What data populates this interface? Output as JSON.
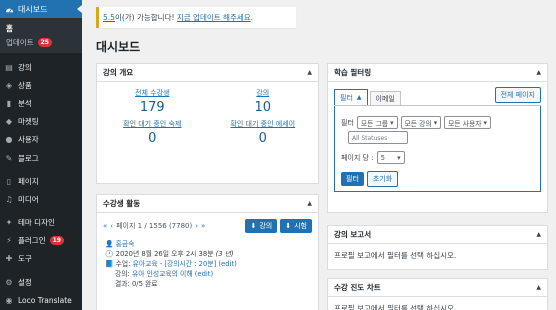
{
  "sidebar": {
    "dashboard_label": "대시보드",
    "sub_items": [
      {
        "label": "홈"
      },
      {
        "label": "업데이트",
        "badge": "25"
      }
    ],
    "items": [
      {
        "label": "강의",
        "icon": "course-icon"
      },
      {
        "label": "상품",
        "icon": "product-icon"
      },
      {
        "label": "분석",
        "icon": "analytics-icon"
      },
      {
        "label": "마켓팅",
        "icon": "marketing-icon"
      },
      {
        "label": "사용자",
        "icon": "users-icon"
      },
      {
        "label": "블로그",
        "icon": "blog-icon"
      }
    ],
    "items2": [
      {
        "label": "페이지",
        "icon": "page-icon"
      },
      {
        "label": "미디어",
        "icon": "media-icon"
      }
    ],
    "items3": [
      {
        "label": "테마 디자인",
        "icon": "theme-icon"
      },
      {
        "label": "플러그인",
        "icon": "plugin-icon",
        "badge": "19"
      },
      {
        "label": "도구",
        "icon": "tools-icon"
      }
    ],
    "items4": [
      {
        "label": "설정",
        "icon": "settings-icon"
      },
      {
        "label": "Loco Translate",
        "icon": "translate-icon"
      }
    ]
  },
  "notice": {
    "version_link": "5.5",
    "text_mid": "이(가) 가능합니다!",
    "update_link": "지금 업데이트 해주세요",
    "text_end": "."
  },
  "page_title": "대시보드",
  "course_overview": {
    "title": "강의 개요",
    "stats": [
      {
        "label": "전체 수강생",
        "value": "179"
      },
      {
        "label": "강의",
        "value": "10"
      },
      {
        "label": "확인 대기 중인 숙제",
        "value": "0"
      },
      {
        "label": "확인 대기 중인 에세이",
        "value": "0"
      }
    ]
  },
  "student_activity": {
    "title": "수강생 활동",
    "first": "«",
    "prev": "‹",
    "page_info": "페이지 1 / 1556 (7780)",
    "next": "›",
    "last": "»",
    "course_btn": "강의",
    "quiz_btn": "시험",
    "entry": {
      "user": "홍금숙",
      "date": "2020년 8월 26일 오후 2시 38분",
      "date_ago": "(3 년)",
      "line1_prefix": "수업:",
      "line1_link": "유아교육 - [강의시간 : 20분]",
      "line1_edit": "(edit)",
      "line2_prefix": "강의:",
      "line2_link": "유아 인성교육의 이해",
      "line2_edit": "(edit)",
      "line3": "결과: 0/5 완료"
    }
  },
  "learning_filter": {
    "title": "학습 필터링",
    "tab_filter": "필터",
    "tab_email": "이메일",
    "all_pages_btn": "전체 페이지",
    "filter_label": "필터",
    "group_select": "모든 그룹",
    "course_select": "모든 강의",
    "user_select": "모든 사용자",
    "status_placeholder": "All Statuses",
    "per_page_label": "페이지 당 :",
    "per_page_value": "5",
    "filter_btn": "필터",
    "reset_btn": "초기화"
  },
  "course_report": {
    "title": "강의 보고서",
    "text": "프로필 보고에서 필터를 선택 하십시오."
  },
  "progress_chart": {
    "title": "수강 진도 차트",
    "text": "프로필 보고에서 필터를 선택 하십시오."
  }
}
